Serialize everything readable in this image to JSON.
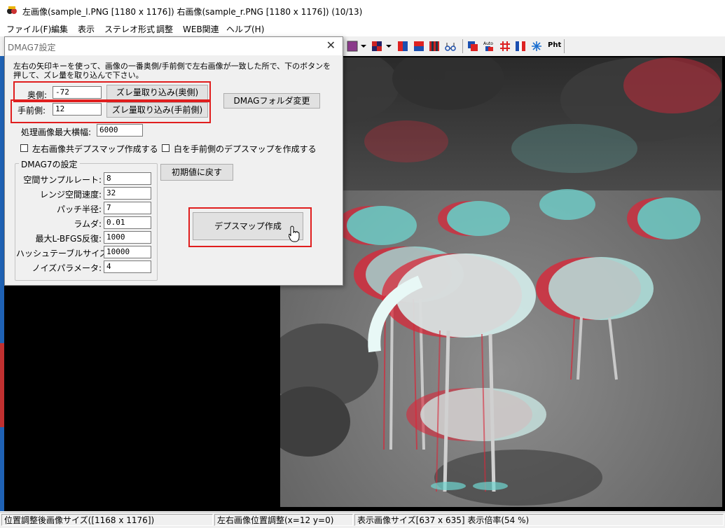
{
  "window": {
    "title": "左画像(sample_l.PNG [1180 x 1176]) 右画像(sample_r.PNG [1180 x 1176])  (10/13)"
  },
  "menu": [
    "ファイル(F)",
    "編集",
    "表示",
    "ステレオ形式",
    "調整",
    "WEB関連",
    "ヘルプ(H)"
  ],
  "toolbar": {
    "pht_label": "Pht",
    "auto_label": "Auto"
  },
  "dialog": {
    "title": "DMAG7設定",
    "close": "✕",
    "description": "左右の矢印キーを使って、画像の一番奥側/手前側で左右画像が一致した所で、下のボタンを押して、ズレ量を取り込んで下さい。",
    "back_label": "奥側:",
    "back_value": "-72",
    "back_button": "ズレ量取り込み(奥側)",
    "front_label": "手前側:",
    "front_value": "12",
    "front_button": "ズレ量取り込み(手前側)",
    "folder_button": "DMAGフォルダ変更",
    "max_width_label": "処理画像最大横幅:",
    "max_width_value": "6000",
    "both_depth_label": "左右画像共デプスマップ作成する",
    "white_front_label": "白を手前側のデプスマップを作成する",
    "group_title": "DMAG7の設定",
    "reset_button": "初期値に戻す",
    "create_button": "デプスマップ作成",
    "params": [
      {
        "label": "空間サンプルレート:",
        "value": "8"
      },
      {
        "label": "レンジ空間速度:",
        "value": "32"
      },
      {
        "label": "パッチ半径:",
        "value": "7"
      },
      {
        "label": "ラムダ:",
        "value": "0.01"
      },
      {
        "label": "最大L-BFGS反復:",
        "value": "1000"
      },
      {
        "label": "ハッシュテーブルサイズ:",
        "value": "10000"
      },
      {
        "label": "ノイズパラメータ:",
        "value": "4"
      }
    ]
  },
  "status": {
    "pane1": "位置調整後画像サイズ([1168 x 1176])",
    "pane2": "左右画像位置調整(x=12 y=0)",
    "pane3": "表示画像サイズ[637 x 635]  表示倍率(54 %)"
  },
  "colors": {
    "highlight": "#e01e1e",
    "accent_blue": "#1f62b5",
    "anaglyph_red": "#d8283a",
    "anaglyph_cyan": "#6fd6d0"
  }
}
